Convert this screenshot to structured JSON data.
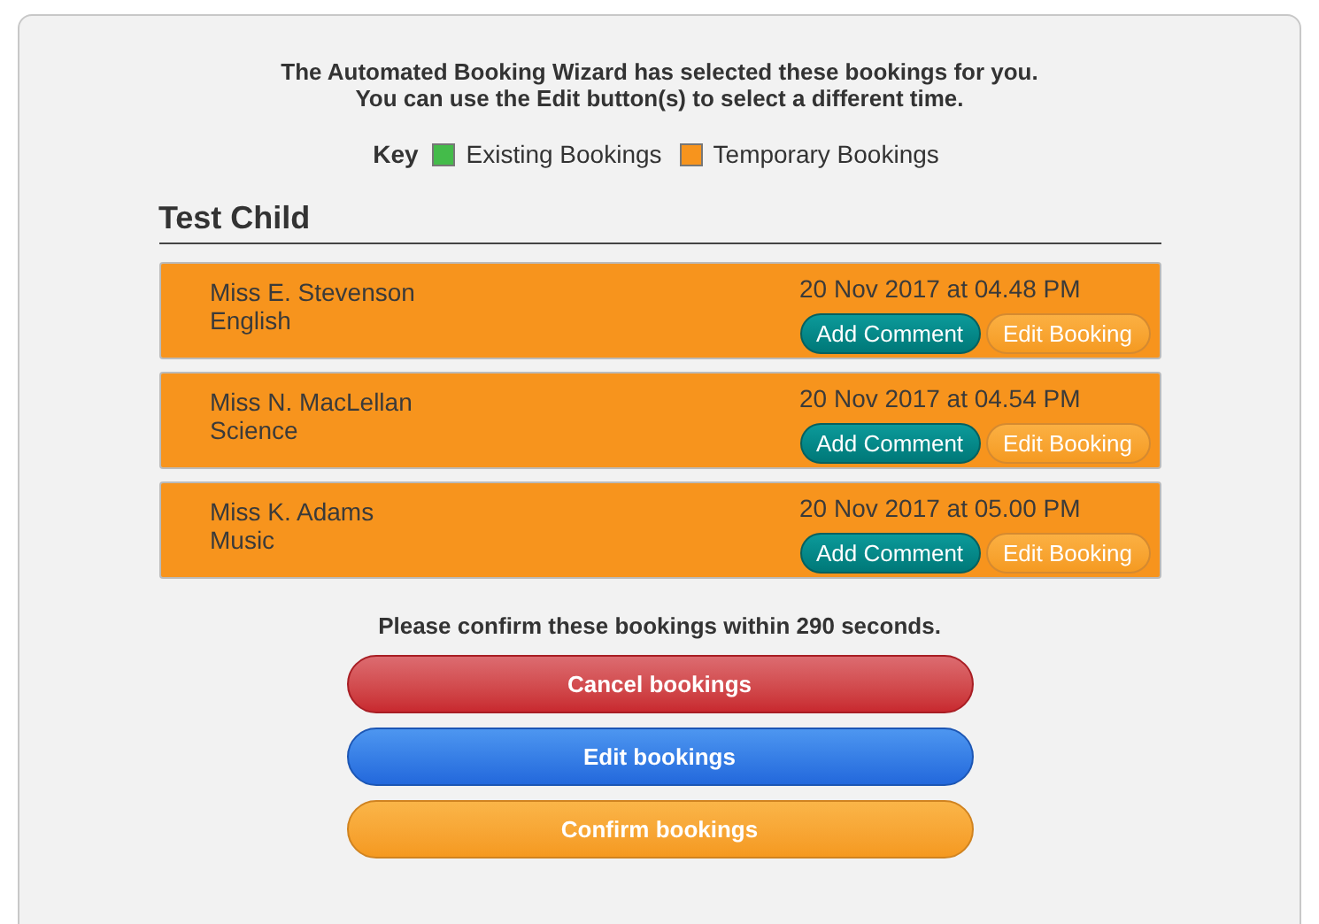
{
  "intro": [
    "The Automated Booking Wizard has selected these bookings for you.",
    "You can use the Edit button(s) to select a different time."
  ],
  "key": {
    "label": "Key",
    "items": [
      {
        "label": "Existing Bookings",
        "color": "#44bb4a"
      },
      {
        "label": "Temporary Bookings",
        "color": "#f7941d"
      }
    ]
  },
  "child": "Test Child",
  "bookings": [
    {
      "teacher": "Miss E. Stevenson",
      "subject": "English",
      "time": "20 Nov 2017 at 04.48 PM",
      "color": "#f7941d",
      "buttons": [
        "Add Comment",
        "Edit Booking"
      ]
    },
    {
      "teacher": "Miss N. MacLellan",
      "subject": "Science",
      "time": "20 Nov 2017 at 04.54 PM",
      "color": "#f7941d",
      "buttons": [
        "Add Comment",
        "Edit Booking"
      ]
    },
    {
      "teacher": "Miss K. Adams",
      "subject": "Music",
      "time": "20 Nov 2017 at 05.00 PM",
      "color": "#f7941d",
      "buttons": [
        "Add Comment",
        "Edit Booking"
      ]
    }
  ],
  "confirm_note": "Please confirm these bookings within 290 seconds.",
  "actions": [
    {
      "label": "Cancel bookings",
      "kind": "cancel"
    },
    {
      "label": "Edit bookings",
      "kind": "edit"
    },
    {
      "label": "Confirm bookings",
      "kind": "confirm"
    }
  ]
}
